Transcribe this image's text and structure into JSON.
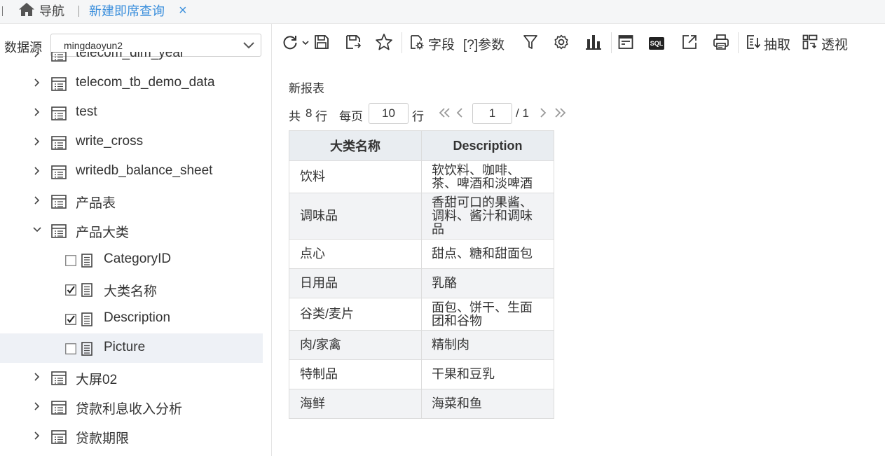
{
  "topbar": {
    "home_label": "导航",
    "tab_label": "新建即席查询",
    "close_glyph": "×"
  },
  "left": {
    "datasource_label": "数据源",
    "datasource_value": "mingdaoyun2",
    "tree": [
      {
        "label": "telecom_dim_year",
        "kind": "table",
        "expanded": false
      },
      {
        "label": "telecom_tb_demo_data",
        "kind": "table",
        "expanded": false
      },
      {
        "label": "test",
        "kind": "table",
        "expanded": false
      },
      {
        "label": "write_cross",
        "kind": "table",
        "expanded": false
      },
      {
        "label": "writedb_balance_sheet",
        "kind": "table",
        "expanded": false
      },
      {
        "label": "产品表",
        "kind": "table",
        "expanded": false
      },
      {
        "label": "产品大类",
        "kind": "table",
        "expanded": true
      },
      {
        "label": "CategoryID",
        "kind": "field",
        "checked": false
      },
      {
        "label": "大类名称",
        "kind": "field",
        "checked": true
      },
      {
        "label": "Description",
        "kind": "field",
        "checked": true
      },
      {
        "label": "Picture",
        "kind": "field",
        "checked": false,
        "selected": true
      },
      {
        "label": "大屏02",
        "kind": "table",
        "expanded": false
      },
      {
        "label": "贷款利息收入分析",
        "kind": "table",
        "expanded": false
      },
      {
        "label": "贷款期限",
        "kind": "table",
        "expanded": false
      }
    ]
  },
  "toolbar": {
    "fields_label": "字段",
    "params_label": "[?]参数",
    "sql_label": "SQL",
    "extract_label": "抽取",
    "pivot_label": "透视",
    "icons": [
      "refresh-icon",
      "save-icon",
      "save-as-icon",
      "favorite-icon",
      "fields-icon",
      "filter-icon",
      "settings-icon",
      "chart-icon",
      "layout-icon",
      "sql-icon",
      "export-icon",
      "print-icon",
      "extract-icon",
      "pivot-icon"
    ]
  },
  "report": {
    "title": "新报表",
    "pager": {
      "total_prefix": "共",
      "total_count": "8",
      "total_suffix": "行",
      "per_page_label": "每页",
      "per_page_value": "10",
      "rows_label": "行",
      "current_page": "1",
      "page_total": "/ 1"
    },
    "columns": [
      "大类名称",
      "Description"
    ],
    "rows": [
      [
        "饮料",
        "软饮料、咖啡、茶、啤酒和淡啤酒"
      ],
      [
        "调味品",
        "香甜可口的果酱、调料、酱汁和调味品"
      ],
      [
        "点心",
        "甜点、糖和甜面包"
      ],
      [
        "日用品",
        "乳酪"
      ],
      [
        "谷类/麦片",
        "面包、饼干、生面团和谷物"
      ],
      [
        "肉/家禽",
        "精制肉"
      ],
      [
        "特制品",
        "干果和豆乳"
      ],
      [
        "海鲜",
        "海菜和鱼"
      ]
    ]
  },
  "colors": {
    "accent": "#3b8fdc",
    "header_bg": "#e9edf1",
    "selected_row_bg": "#eef1f6"
  }
}
